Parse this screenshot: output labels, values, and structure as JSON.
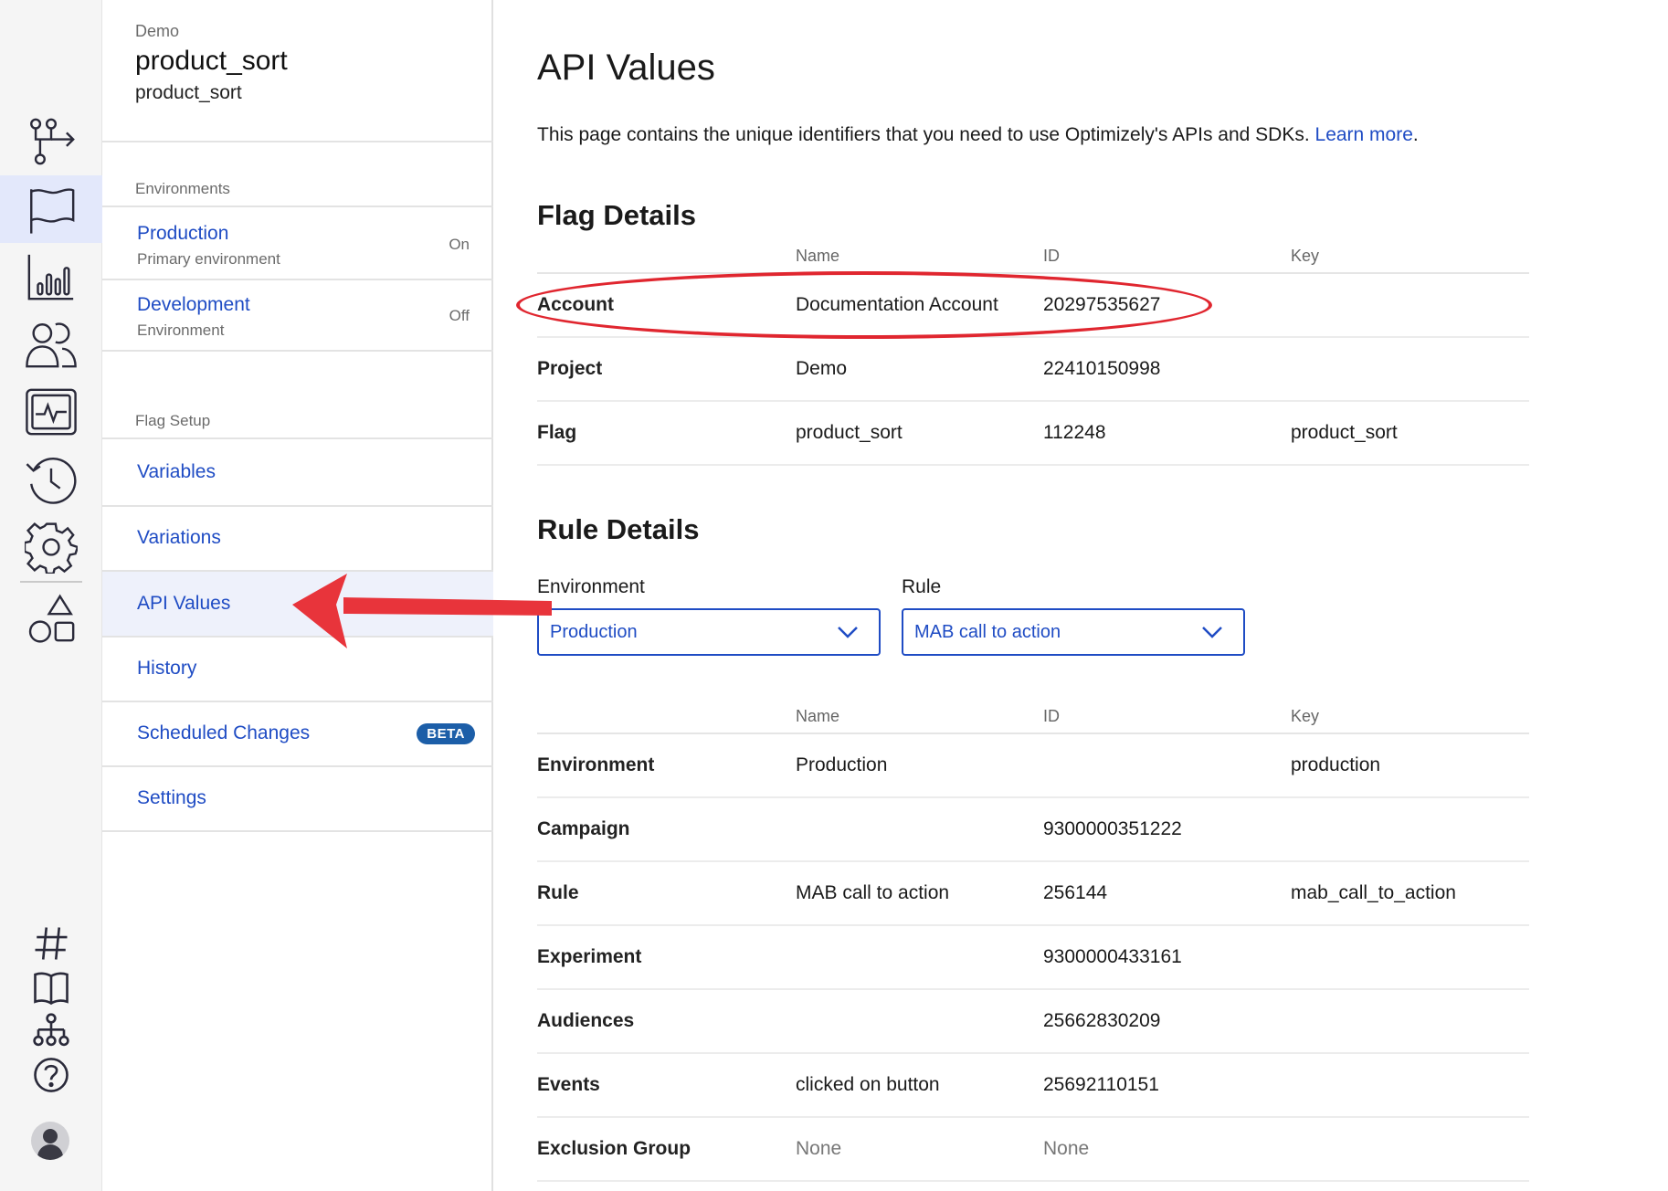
{
  "sidebar": {
    "project_label": "Demo",
    "flag_name": "product_sort",
    "flag_key": "product_sort",
    "environments_label": "Environments",
    "environments": [
      {
        "name": "Production",
        "subtitle": "Primary environment",
        "state": "On"
      },
      {
        "name": "Development",
        "subtitle": "Environment",
        "state": "Off"
      }
    ],
    "flag_setup_label": "Flag Setup",
    "nav": [
      {
        "label": "Variables"
      },
      {
        "label": "Variations"
      },
      {
        "label": "API Values",
        "active": true
      },
      {
        "label": "History"
      },
      {
        "label": "Scheduled Changes",
        "badge": "BETA"
      },
      {
        "label": "Settings"
      }
    ]
  },
  "rail": {
    "icons": [
      "flow-icon",
      "flag-icon",
      "bar-chart-icon",
      "users-icon",
      "monitor-pulse-icon",
      "history-icon",
      "gear-icon",
      "shapes-icon",
      "hash-icon",
      "book-icon",
      "hierarchy-icon",
      "help-icon",
      "avatar"
    ],
    "active": "flag-icon"
  },
  "main": {
    "title": "API Values",
    "intro_text": "This page contains the unique identifiers that you need to use Optimizely's APIs and SDKs.",
    "intro_link": "Learn more",
    "intro_end": ".",
    "flag_details": {
      "heading": "Flag Details",
      "columns": [
        "",
        "Name",
        "ID",
        "Key"
      ],
      "rows": [
        {
          "label": "Account",
          "name": "Documentation Account",
          "id": "20297535627",
          "key": ""
        },
        {
          "label": "Project",
          "name": "Demo",
          "id": "22410150998",
          "key": ""
        },
        {
          "label": "Flag",
          "name": "product_sort",
          "id": "112248",
          "key": "product_sort"
        }
      ]
    },
    "rule_details": {
      "heading": "Rule Details",
      "environment_label": "Environment",
      "environment_value": "Production",
      "rule_label": "Rule",
      "rule_value": "MAB call to action",
      "columns": [
        "",
        "Name",
        "ID",
        "Key"
      ],
      "rows": [
        {
          "label": "Environment",
          "name": "Production",
          "id": "",
          "key": "production"
        },
        {
          "label": "Campaign",
          "name": "",
          "id": "9300000351222",
          "key": ""
        },
        {
          "label": "Rule",
          "name": "MAB call to action",
          "id": "256144",
          "key": "mab_call_to_action"
        },
        {
          "label": "Experiment",
          "name": "",
          "id": "9300000433161",
          "key": ""
        },
        {
          "label": "Audiences",
          "name": "",
          "id": "25662830209",
          "key": ""
        },
        {
          "label": "Events",
          "name": "clicked on button",
          "id": "25692110151",
          "key": ""
        },
        {
          "label": "Exclusion Group",
          "name": "None",
          "id": "None",
          "key": ""
        }
      ]
    }
  },
  "colors": {
    "accent": "#1f4cc4",
    "annotation": "#e0262f",
    "badge": "#1c5ea8",
    "active_bg": "#eef1fb"
  }
}
